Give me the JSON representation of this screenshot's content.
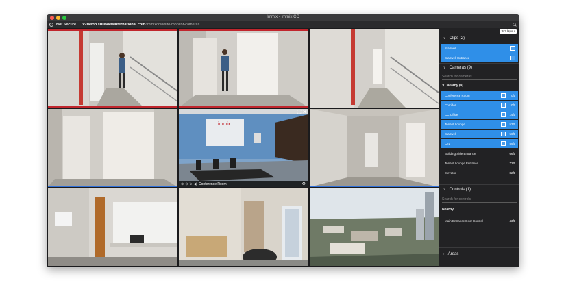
{
  "window": {
    "title": "Immix - Immix CC",
    "dot_colors": [
      "#fd5c56",
      "#febc2e",
      "#29c840"
    ]
  },
  "urlbar": {
    "security": "Not Secure",
    "host": "v2demo.sureviewinternational.com",
    "path": "/immixcc/#/site-monitor-cameras",
    "icons": [
      "info-icon",
      "search-icon"
    ]
  },
  "cameras_grid": {
    "selected_camera_label": "Conference Room",
    "selected_controls_icons": [
      "zoom-in-icon",
      "zoom-out-icon",
      "rotate-icon",
      "audio-icon"
    ],
    "accent_selected": "#2f8fd8",
    "accent_recording": "#c0262d"
  },
  "sidebar": {
    "layout_button": "3x3 layout",
    "clips": {
      "header": "Clips (2)",
      "items": [
        {
          "label": "Stairwell"
        },
        {
          "label": "Stairwell Entrance"
        }
      ]
    },
    "cameras": {
      "header": "Cameras (9)",
      "search_placeholder": "Search for cameras",
      "group": "Nearby (9)",
      "items": [
        {
          "label": "Conference Room",
          "dist": "0ft",
          "selected": true
        },
        {
          "label": "Corridor",
          "dist": "10ft",
          "selected": true
        },
        {
          "label": "CC Office",
          "dist": "14ft",
          "selected": true
        },
        {
          "label": "Tenant Lounge",
          "dist": "53ft",
          "selected": true
        },
        {
          "label": "Stairwell",
          "dist": "56ft",
          "selected": true
        },
        {
          "label": "City",
          "dist": "59ft",
          "selected": true
        },
        {
          "label": "Building Side Entrance",
          "dist": "66ft",
          "selected": false
        },
        {
          "label": "Tenant Lounge Entrance",
          "dist": "72ft",
          "selected": false
        },
        {
          "label": "Elevator",
          "dist": "82ft",
          "selected": false
        }
      ]
    },
    "controls": {
      "header": "Controls (1)",
      "search_placeholder": "Search for controls",
      "group": "Nearby",
      "items": [
        {
          "label": "Main Entrance Door Control",
          "dist": "43ft"
        }
      ]
    },
    "areas": {
      "header": "Areas"
    }
  }
}
